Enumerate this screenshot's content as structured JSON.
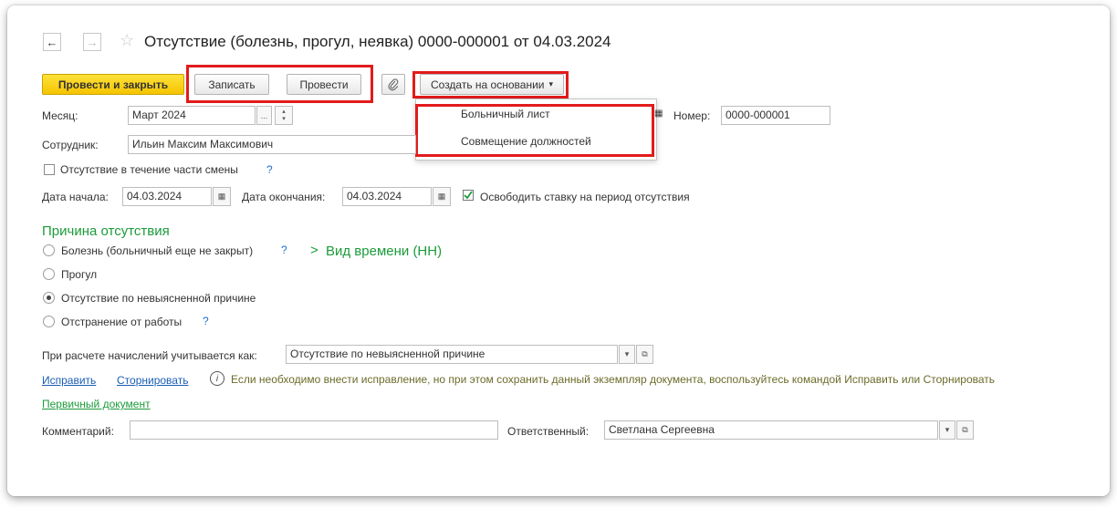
{
  "window": {
    "title": "Отсутствие (болезнь, прогул, неявка) 0000-000001 от 04.03.2024",
    "nav_back": "←",
    "nav_forward": "→",
    "star": "☆"
  },
  "toolbar": {
    "post_close": "Провести и закрыть",
    "save": "Записать",
    "post": "Провести",
    "attach_icon": "paperclip-icon",
    "create_based": "Создать на основании",
    "create_based_arrow": "▾"
  },
  "create_based_menu": {
    "items": [
      "Больничный лист",
      "Совмещение должностей"
    ]
  },
  "form": {
    "month_label": "Месяц:",
    "month_value": "Март 2024",
    "month_btn": "...",
    "number_label": "Номер:",
    "number_value": "0000-000001",
    "employee_label": "Сотрудник:",
    "employee_value": "Ильин Максим Максимович",
    "partial_shift_label": "Отсутствие в течение части смены",
    "help": "?",
    "start_label": "Дата начала:",
    "start_value": "04.03.2024",
    "end_label": "Дата окончания:",
    "end_value": "04.03.2024",
    "free_rate_label": "Освободить ставку на период отсутствия"
  },
  "reason": {
    "heading": "Причина отсутствия",
    "options": [
      "Болезнь (больничный еще не закрыт)",
      "Прогул",
      "Отсутствие по невыясненной причине",
      "Отстранение от работы"
    ],
    "selected_index": 2,
    "time_type": "Вид времени (НН)",
    "time_type_chevron": ">"
  },
  "calc": {
    "label": "При расчете начислений учитывается как:",
    "value": "Отсутствие по невыясненной причине"
  },
  "links": {
    "fix": "Исправить",
    "reverse": "Сторнировать",
    "info_text": "Если необходимо внести исправление, но при этом сохранить данный экземпляр документа, воспользуйтесь командой Исправить или Сторнировать",
    "primary_doc": "Первичный документ"
  },
  "footer": {
    "comment_label": "Комментарий:",
    "comment_value": "",
    "responsible_label": "Ответственный:",
    "responsible_value": "Светлана Сергеевна"
  },
  "colors": {
    "highlight": "#e21b1b",
    "primary_button": "#f5c400",
    "section_green": "#1b9b3a",
    "link_blue": "#1a5fb4"
  }
}
